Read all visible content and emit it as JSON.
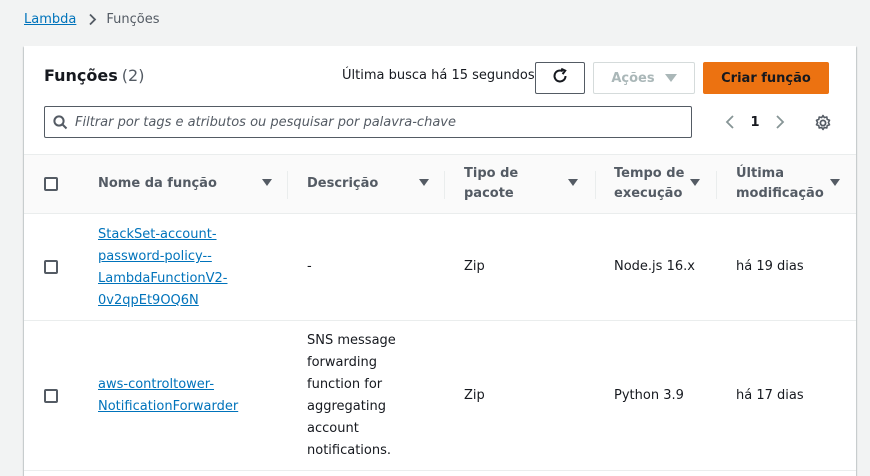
{
  "breadcrumb": {
    "root": "Lambda",
    "current": "Funções"
  },
  "panel": {
    "title": "Funções",
    "count": "(2)",
    "last_fetch": "Última busca há 15 segundos",
    "actions_label": "Ações",
    "create_label": "Criar função"
  },
  "search": {
    "placeholder": "Filtrar por tags e atributos ou pesquisar por palavra-chave",
    "value": ""
  },
  "pagination": {
    "current_page": "1"
  },
  "table": {
    "headers": {
      "name": "Nome da função",
      "description": "Descrição",
      "package": "Tipo de\npacote",
      "runtime": "Tempo de\nexecução",
      "modified": "Última\nmodificação"
    },
    "rows": [
      {
        "name": "StackSet-account-\npassword-policy--\nLambdaFunctionV2-\n0v2qpEt9OQ6N",
        "description": "-",
        "package": "Zip",
        "runtime": "Node.js 16.x",
        "modified": "há 19 dias"
      },
      {
        "name": "aws-controltower-\nNotificationForwarder",
        "description": "SNS message\nforwarding\nfunction for\naggregating\naccount\nnotifications.",
        "package": "Zip",
        "runtime": "Python 3.9",
        "modified": "há 17 dias"
      }
    ]
  },
  "colors": {
    "link": "#0073bb",
    "primary_button": "#ec7211",
    "text": "#16191f",
    "muted": "#545b64"
  },
  "icons": [
    "chevron-right-icon",
    "refresh-icon",
    "caret-down-icon",
    "search-icon",
    "chevron-left-icon",
    "gear-icon",
    "sort-icon"
  ]
}
